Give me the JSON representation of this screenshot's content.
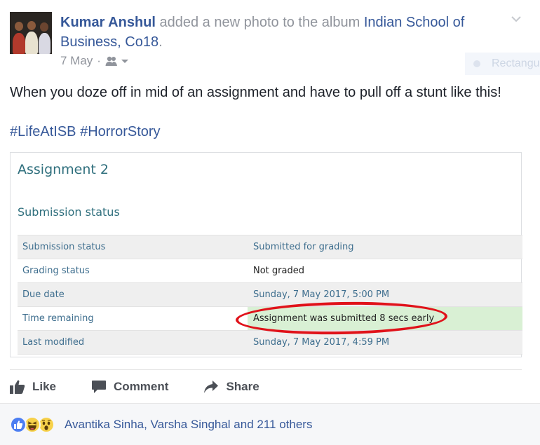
{
  "post": {
    "actor": "Kumar Anshul",
    "action": " added a new photo to the album ",
    "album": "Indian School of Business, Co18",
    "album_suffix": ".",
    "date": "7 May",
    "separator": "·",
    "audience_icon": "friends-icon",
    "message": "When you doze off in mid of an assignment and have to pull off a stunt like this!",
    "hashtags": [
      "#LifeAtISB",
      "#HorrorStory"
    ],
    "ghost_label": "Rectangu"
  },
  "screenshot": {
    "title": "Assignment 2",
    "subtitle": "Submission status",
    "rows": [
      {
        "label": "Submission status",
        "value": "Submitted for grading"
      },
      {
        "label": "Grading status",
        "value": "Not graded"
      },
      {
        "label": "Due date",
        "value": "Sunday, 7 May 2017, 5:00 PM"
      },
      {
        "label": "Time remaining",
        "value": "Assignment was submitted 8 secs early"
      },
      {
        "label": "Last modified",
        "value": "Sunday, 7 May 2017, 4:59 PM"
      }
    ],
    "highlight_color": "#e0121a"
  },
  "actions": {
    "like": "Like",
    "comment": "Comment",
    "share": "Share"
  },
  "reactions": {
    "icons": [
      "like-reaction-icon",
      "haha-reaction-icon",
      "wow-reaction-icon"
    ],
    "summary": "Avantika Sinha, Varsha Singhal and 211 others"
  },
  "colors": {
    "link": "#365899",
    "text": "#1d2129",
    "muted": "#90949c"
  }
}
